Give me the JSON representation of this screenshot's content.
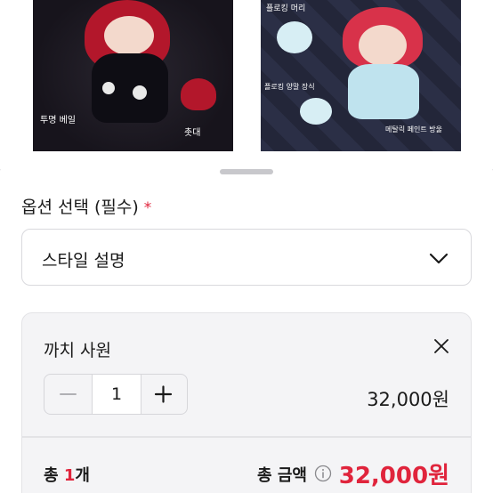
{
  "photos": {
    "left_caption_veil": "투명 베일",
    "left_caption_candle": "촛대",
    "right_caption_top": "플로킹 머리",
    "right_caption_a": "플로킹 양말 장식",
    "right_caption_b": "메탈릭 페인트 방울"
  },
  "option": {
    "title": "옵션 선택 (필수)",
    "required_mark": "*",
    "select_value": "스타일 설명"
  },
  "item": {
    "name": "까치 사원",
    "quantity": "1",
    "minus_label": "−",
    "plus_label": "+",
    "price": "32,000원"
  },
  "total": {
    "count_prefix": "총 ",
    "count_num": "1",
    "count_suffix": "개",
    "label": "총 금액",
    "amount": "32,000원"
  },
  "colors": {
    "accent": "#e0243c"
  }
}
